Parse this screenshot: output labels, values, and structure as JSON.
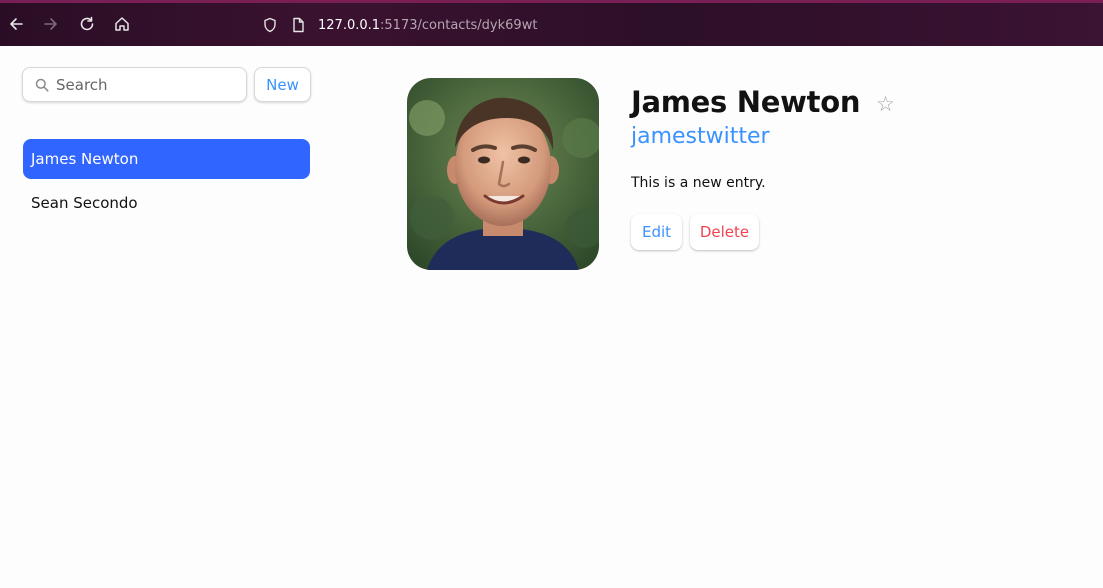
{
  "browser": {
    "url_host": "127.0.0.1",
    "url_path": ":5173/contacts/dyk69wt",
    "theme_color": "#2c0f28"
  },
  "sidebar": {
    "search_placeholder": "Search",
    "new_label": "New",
    "contacts": [
      {
        "name": "James Newton",
        "active": true
      },
      {
        "name": "Sean Secondo",
        "active": false
      }
    ]
  },
  "contact": {
    "name": "James Newton",
    "favorite_icon": "☆",
    "twitter": "jamestwitter",
    "notes": "This is a new entry.",
    "edit_label": "Edit",
    "delete_label": "Delete"
  },
  "colors": {
    "accent": "#3992ff",
    "active_bg": "#3065ff",
    "danger": "#f44250"
  }
}
